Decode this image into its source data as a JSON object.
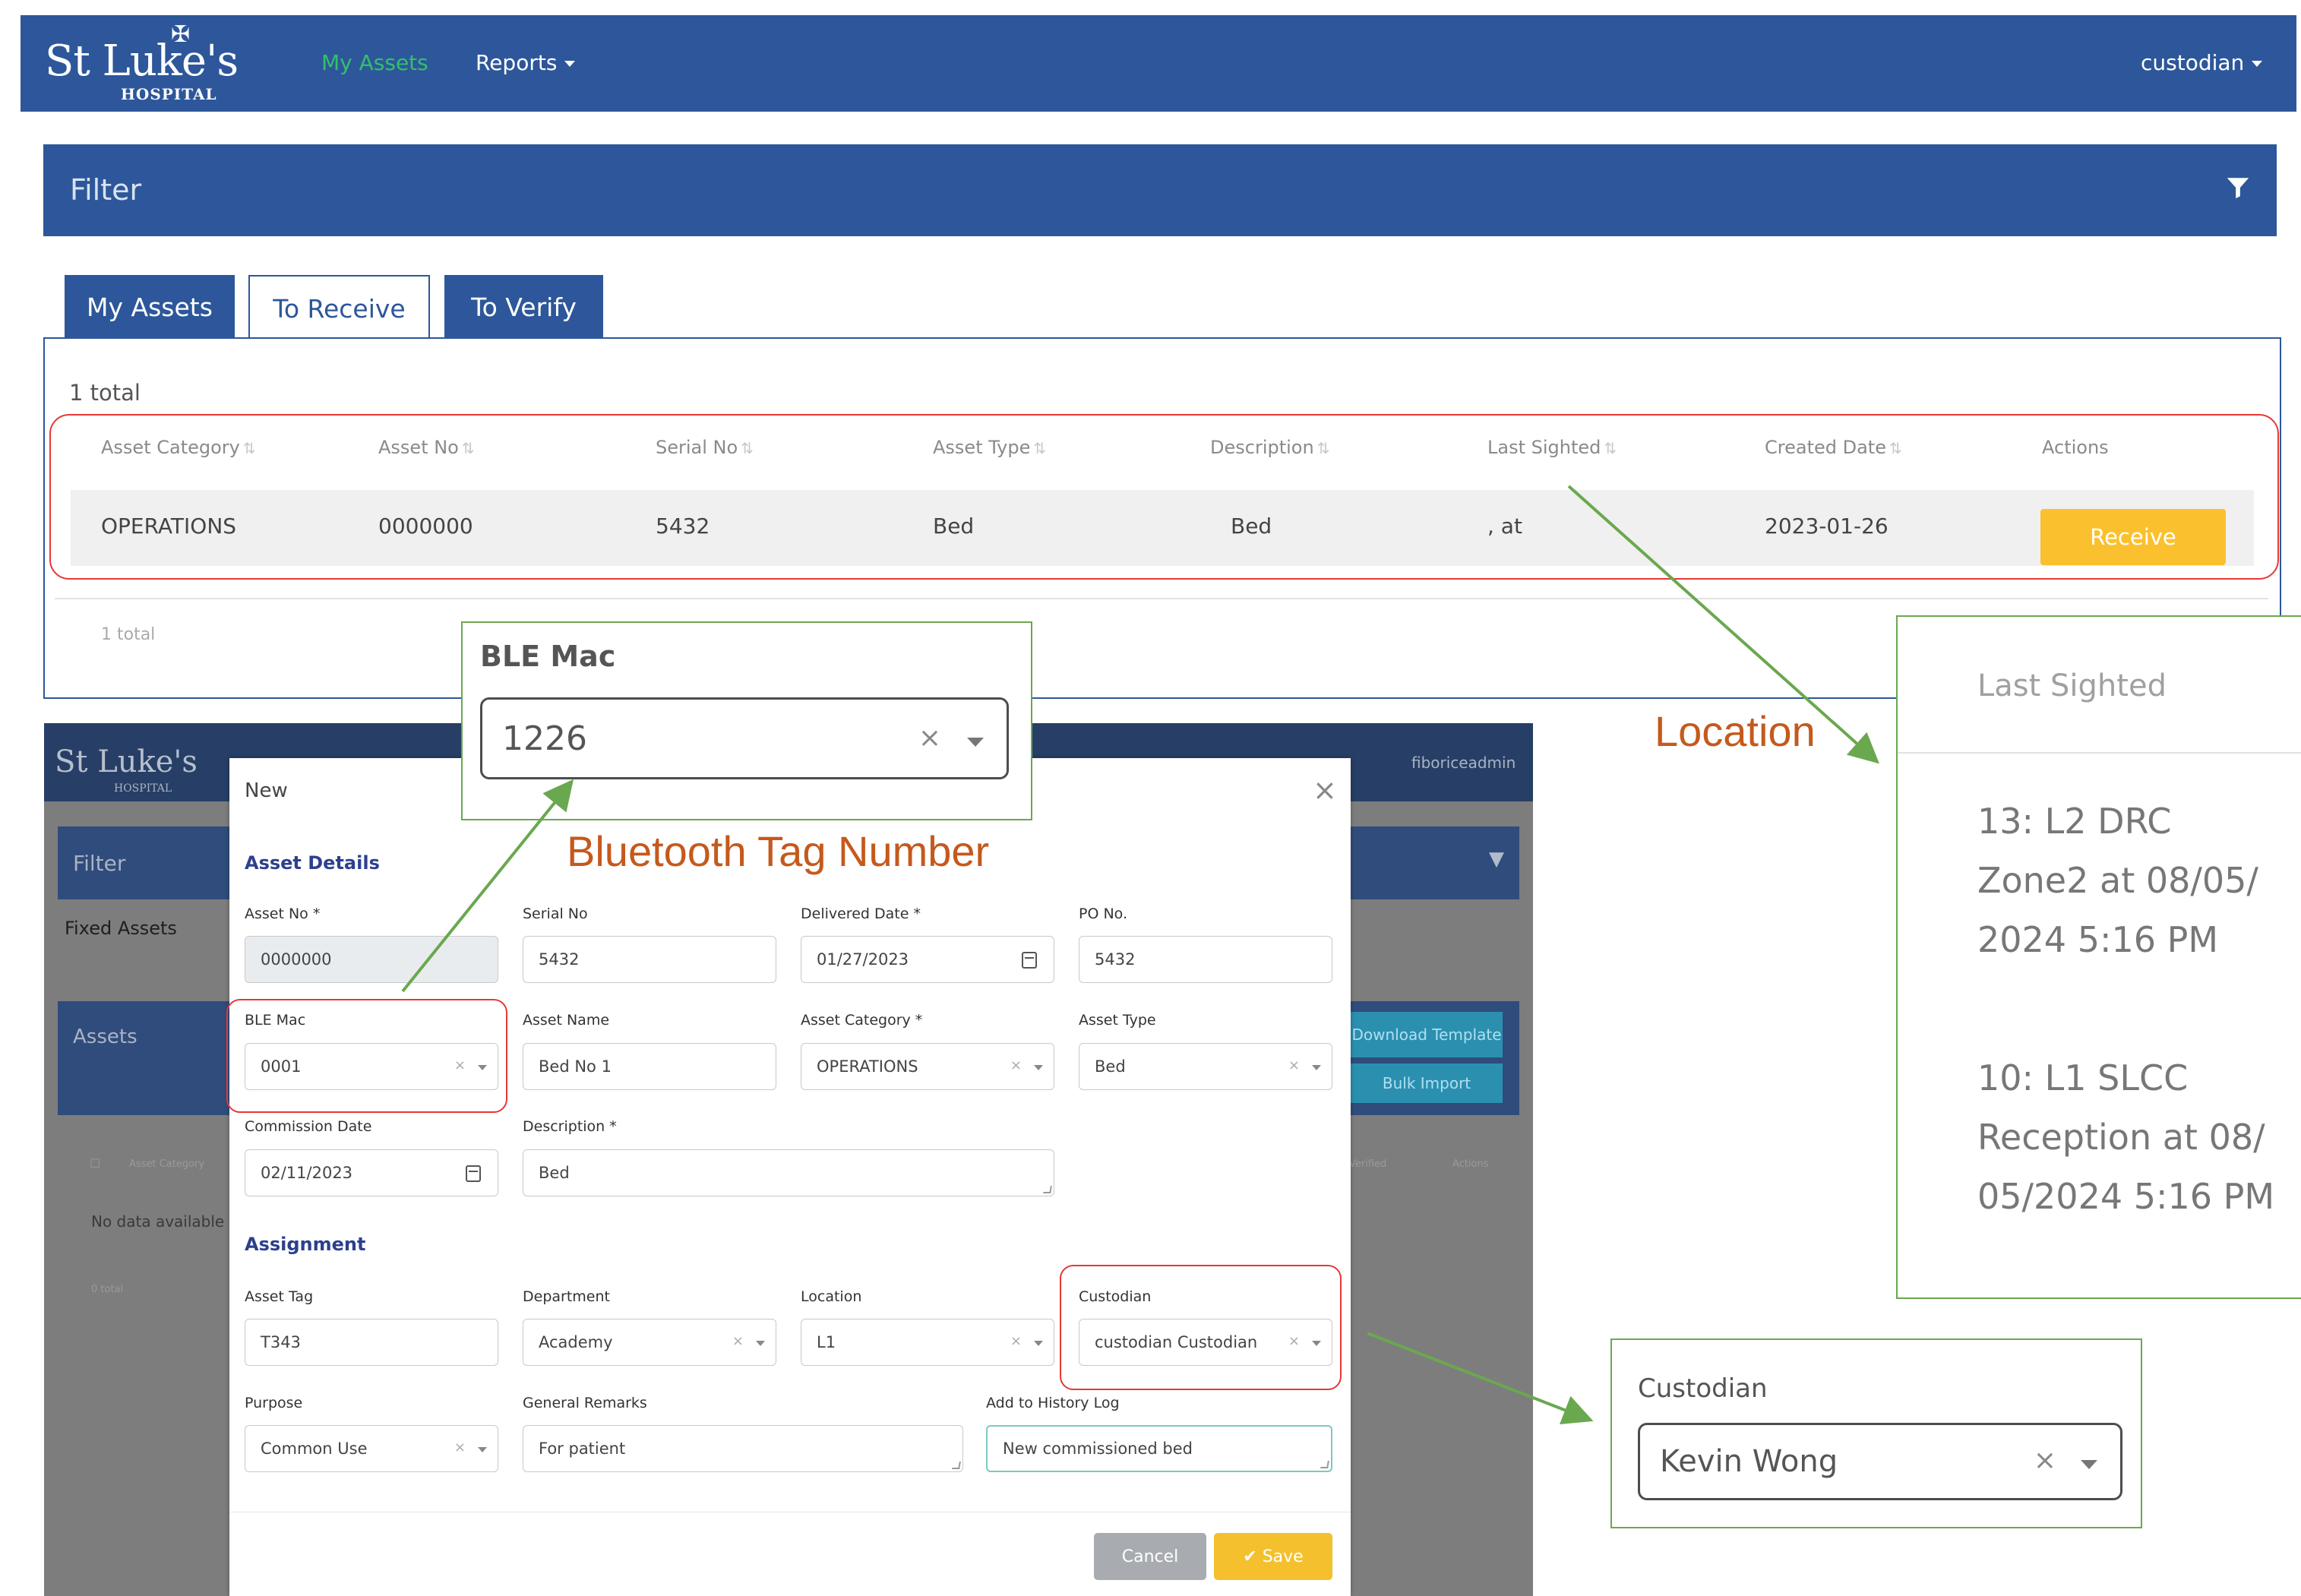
{
  "app": {
    "logo_name": "St Luke's",
    "logo_sub": "HOSPITAL",
    "nav_my_assets": "My Assets",
    "nav_reports": "Reports",
    "user": "custodian"
  },
  "filter": {
    "title": "Filter"
  },
  "tabs": [
    {
      "label": "My Assets"
    },
    {
      "label": "To Receive"
    },
    {
      "label": "To Verify"
    }
  ],
  "table": {
    "total_top": "1 total",
    "total_bottom": "1 total",
    "headers": [
      "Asset Category",
      "Asset No",
      "Serial No",
      "Asset Type",
      "Description",
      "Last Sighted",
      "Created Date",
      "Actions"
    ],
    "row": {
      "category": "OPERATIONS",
      "asset_no": "0000000",
      "serial_no": "5432",
      "asset_type": "Bed",
      "description": "Bed",
      "last_sighted": ", at",
      "created_date": "2023-01-26",
      "action": "Receive"
    }
  },
  "bg_app": {
    "logo_name": "St Luke's",
    "logo_sub": "HOSPITAL",
    "user": "fiboriceadmin",
    "filter": "Filter",
    "fixed_assets": "Fixed Assets",
    "assets": "Assets",
    "download_template": "Download Template",
    "bulk_import": "Bulk Import",
    "col_category": "Asset Category",
    "col_verified": "Verified",
    "col_actions": "Actions",
    "no_data": "No data available",
    "total": "0 total"
  },
  "modal": {
    "title": "New",
    "section_details": "Asset Details",
    "section_assignment": "Assignment",
    "fields": {
      "asset_no": {
        "label": "Asset No *",
        "value": "0000000"
      },
      "serial_no": {
        "label": "Serial No",
        "value": "5432"
      },
      "delivered_date": {
        "label": "Delivered Date *",
        "value": "01/27/2023"
      },
      "po_no": {
        "label": "PO No.",
        "value": "5432"
      },
      "ble_mac": {
        "label": "BLE Mac",
        "value": "0001"
      },
      "asset_name": {
        "label": "Asset Name",
        "value": "Bed No 1"
      },
      "asset_category": {
        "label": "Asset Category *",
        "value": "OPERATIONS"
      },
      "asset_type": {
        "label": "Asset Type",
        "value": "Bed"
      },
      "commission_date": {
        "label": "Commission Date",
        "value": "02/11/2023"
      },
      "description": {
        "label": "Description *",
        "value": "Bed"
      },
      "asset_tag": {
        "label": "Asset Tag",
        "value": "T343"
      },
      "department": {
        "label": "Department",
        "value": "Academy"
      },
      "location": {
        "label": "Location",
        "value": "L1"
      },
      "custodian": {
        "label": "Custodian",
        "value": "custodian Custodian"
      },
      "purpose": {
        "label": "Purpose",
        "value": "Common Use"
      },
      "general_remarks": {
        "label": "General Remarks",
        "value": "For patient"
      },
      "history_log": {
        "label": "Add to History Log",
        "value": "New commissioned bed"
      }
    },
    "cancel": "Cancel",
    "save": "Save"
  },
  "callouts": {
    "ble_title": "BLE Mac",
    "ble_value": "1226",
    "ble_annotation": "Bluetooth Tag Number",
    "location_annotation": "Location",
    "sighted_header": "Last Sighted",
    "sighted_entry_1": [
      "13: L2 DRC",
      "Zone2 at 08/05/",
      "2024 5:16 PM"
    ],
    "sighted_entry_2": [
      "10: L1 SLCC",
      "Reception at 08/",
      "05/2024 5:16 PM"
    ],
    "custodian_title": "Custodian",
    "custodian_value": "Kevin Wong"
  },
  "colors": {
    "nav_blue": "#2d579a",
    "active_green": "#33c06a",
    "receive_yellow": "#fbc02d",
    "highlight_red": "#e53935",
    "callout_green": "#6aa84f",
    "annotation_orange": "#c5591c"
  }
}
